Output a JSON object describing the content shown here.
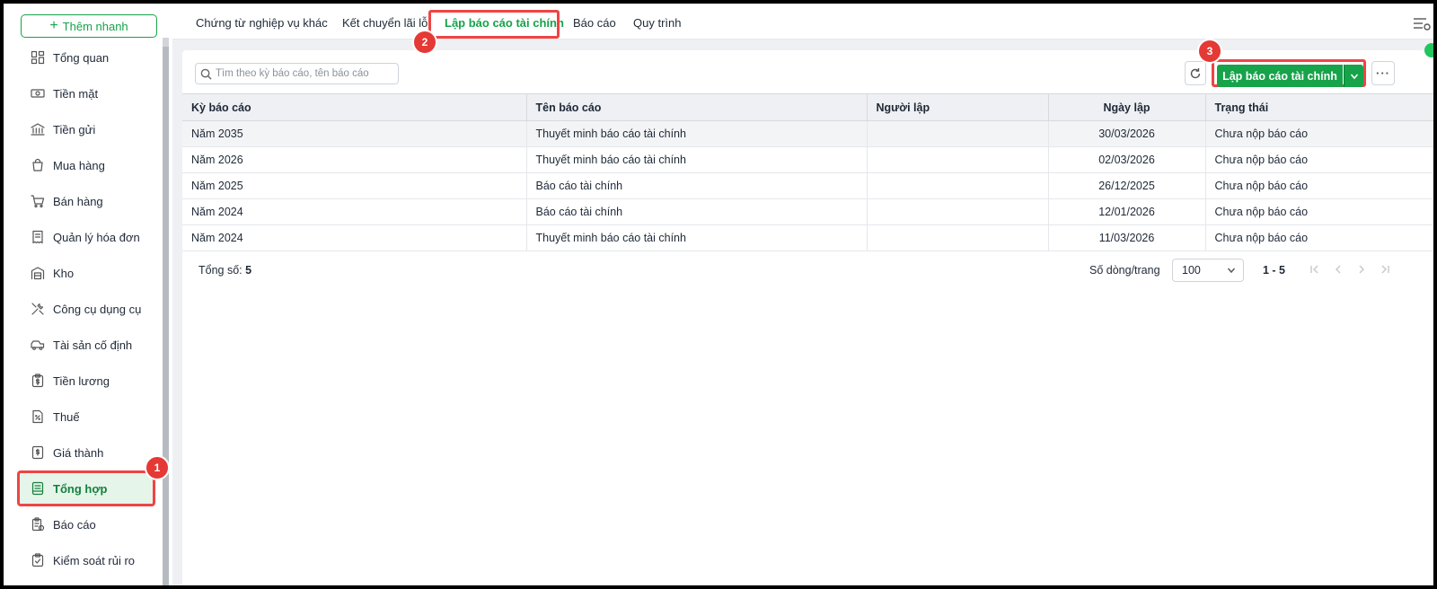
{
  "sidebar": {
    "quick_add_label": "Thêm nhanh",
    "items": [
      {
        "label": "Tổng quan",
        "icon": "dashboard-icon"
      },
      {
        "label": "Tiền mặt",
        "icon": "cash-icon"
      },
      {
        "label": "Tiền gửi",
        "icon": "bank-icon"
      },
      {
        "label": "Mua hàng",
        "icon": "shopping-bag-icon"
      },
      {
        "label": "Bán hàng",
        "icon": "cart-icon"
      },
      {
        "label": "Quản lý hóa đơn",
        "icon": "invoice-icon"
      },
      {
        "label": "Kho",
        "icon": "warehouse-icon"
      },
      {
        "label": "Công cụ dụng cụ",
        "icon": "tools-icon"
      },
      {
        "label": "Tài sản cố định",
        "icon": "vehicle-icon"
      },
      {
        "label": "Tiền lương",
        "icon": "salary-icon"
      },
      {
        "label": "Thuế",
        "icon": "tax-icon"
      },
      {
        "label": "Giá thành",
        "icon": "cost-icon"
      },
      {
        "label": "Tổng hợp",
        "icon": "ledger-icon",
        "active": true
      },
      {
        "label": "Báo cáo",
        "icon": "report-icon"
      },
      {
        "label": "Kiểm soát rủi ro",
        "icon": "risk-icon"
      }
    ]
  },
  "tabs": [
    {
      "label": "Chứng từ nghiệp vụ khác"
    },
    {
      "label": "Kết chuyển lãi lỗ"
    },
    {
      "label": "Lập báo cáo tài chính",
      "active": true
    },
    {
      "label": "Báo cáo"
    },
    {
      "label": "Quy trình"
    }
  ],
  "badges": {
    "one": "1",
    "two": "2",
    "three": "3"
  },
  "toolbar": {
    "search_placeholder": "Tìm theo kỳ báo cáo, tên báo cáo",
    "primary_button": "Lập báo cáo tài chính",
    "more_label": "···"
  },
  "table": {
    "headers": [
      "Kỳ báo cáo",
      "Tên báo cáo",
      "Người lập",
      "Ngày lập",
      "Trạng thái"
    ],
    "rows": [
      {
        "period": "Năm 2035",
        "name": "Thuyết minh báo cáo tài chính",
        "creator": "",
        "date": "30/03/2026",
        "status": "Chưa nộp báo cáo"
      },
      {
        "period": "Năm 2026",
        "name": "Thuyết minh báo cáo tài chính",
        "creator": "",
        "date": "02/03/2026",
        "status": "Chưa nộp báo cáo"
      },
      {
        "period": "Năm 2025",
        "name": "Báo cáo tài chính",
        "creator": "",
        "date": "26/12/2025",
        "status": "Chưa nộp báo cáo"
      },
      {
        "period": "Năm 2024",
        "name": "Báo cáo tài chính",
        "creator": "",
        "date": "12/01/2026",
        "status": "Chưa nộp báo cáo"
      },
      {
        "period": "Năm 2024",
        "name": "Thuyết minh báo cáo tài chính",
        "creator": "",
        "date": "11/03/2026",
        "status": "Chưa nộp báo cáo"
      }
    ]
  },
  "footer": {
    "total_label": "Tổng số:",
    "total_value": "5",
    "rows_per_page_label": "Số dòng/trang",
    "rows_per_page_value": "100",
    "range": "1 - 5"
  },
  "colors": {
    "accent": "#16a34a",
    "highlight": "#ef4444",
    "active_bg": "#e6f5ea"
  }
}
